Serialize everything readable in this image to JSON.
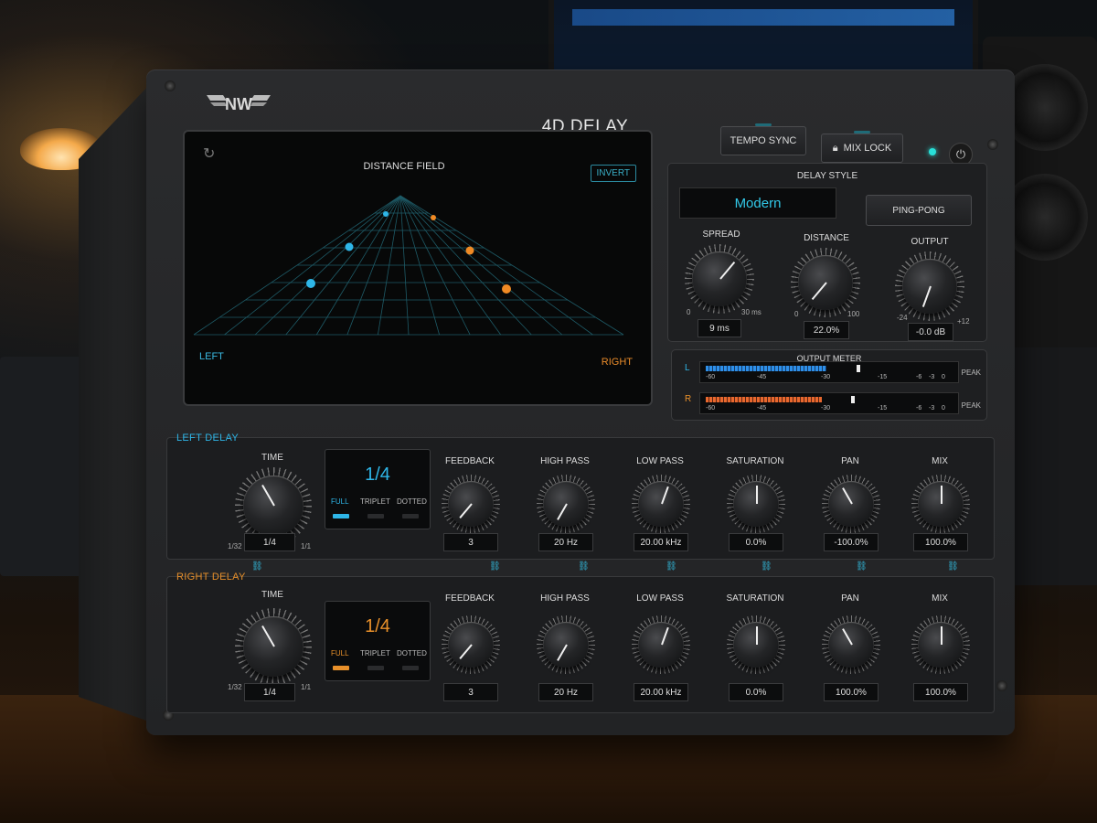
{
  "plugin": {
    "title": "4D DELAY",
    "logo_text": "NW",
    "tempo_sync_label": "TEMPO SYNC",
    "mix_lock_label": "MIX LOCK"
  },
  "distance_field": {
    "title": "DISTANCE FIELD",
    "invert_label": "INVERT",
    "left_label": "LEFT",
    "right_label": "RIGHT",
    "colors": {
      "left": "#2eb6e8",
      "right": "#f08a24",
      "grid": "#1e5a66"
    }
  },
  "delay_style": {
    "title": "DELAY STYLE",
    "value": "Modern",
    "ping_pong_label": "PING-PONG",
    "knobs": [
      {
        "label": "SPREAD",
        "value": "9 ms",
        "min": "0",
        "max": "30 ms"
      },
      {
        "label": "DISTANCE",
        "value": "22.0%",
        "min": "0",
        "max": "100"
      },
      {
        "label": "OUTPUT",
        "value": "-0.0 dB",
        "min": "-24",
        "max": "+12"
      }
    ]
  },
  "output_meter": {
    "title": "OUTPUT METER",
    "left_label": "L",
    "right_label": "R",
    "peak_label": "PEAK",
    "scale": [
      "-60",
      "-45",
      "-30",
      "-15",
      "-6",
      "-3",
      "0"
    ],
    "left_level": 0.49,
    "right_level": 0.47
  },
  "left_delay": {
    "title": "LEFT DELAY",
    "time_label": "TIME",
    "time_value": "1/4",
    "time_min": "1/32",
    "time_max": "1/1",
    "display_value": "1/4",
    "modes": [
      "FULL",
      "TRIPLET",
      "DOTTED"
    ],
    "knobs": [
      {
        "label": "FEEDBACK",
        "value": "3"
      },
      {
        "label": "HIGH PASS",
        "value": "20 Hz"
      },
      {
        "label": "LOW PASS",
        "value": "20.00 kHz"
      },
      {
        "label": "SATURATION",
        "value": "0.0%"
      },
      {
        "label": "PAN",
        "value": "-100.0%"
      },
      {
        "label": "MIX",
        "value": "100.0%"
      }
    ]
  },
  "right_delay": {
    "title": "RIGHT DELAY",
    "time_label": "TIME",
    "time_value": "1/4",
    "time_min": "1/32",
    "time_max": "1/1",
    "display_value": "1/4",
    "modes": [
      "FULL",
      "TRIPLET",
      "DOTTED"
    ],
    "knobs": [
      {
        "label": "FEEDBACK",
        "value": "3"
      },
      {
        "label": "HIGH PASS",
        "value": "20 Hz"
      },
      {
        "label": "LOW PASS",
        "value": "20.00 kHz"
      },
      {
        "label": "SATURATION",
        "value": "0.0%"
      },
      {
        "label": "PAN",
        "value": "100.0%"
      },
      {
        "label": "MIX",
        "value": "100.0%"
      }
    ]
  },
  "colors": {
    "accent_left": "#2eb6e8",
    "accent_right": "#e8902a",
    "panel": "#1c1d1f"
  }
}
